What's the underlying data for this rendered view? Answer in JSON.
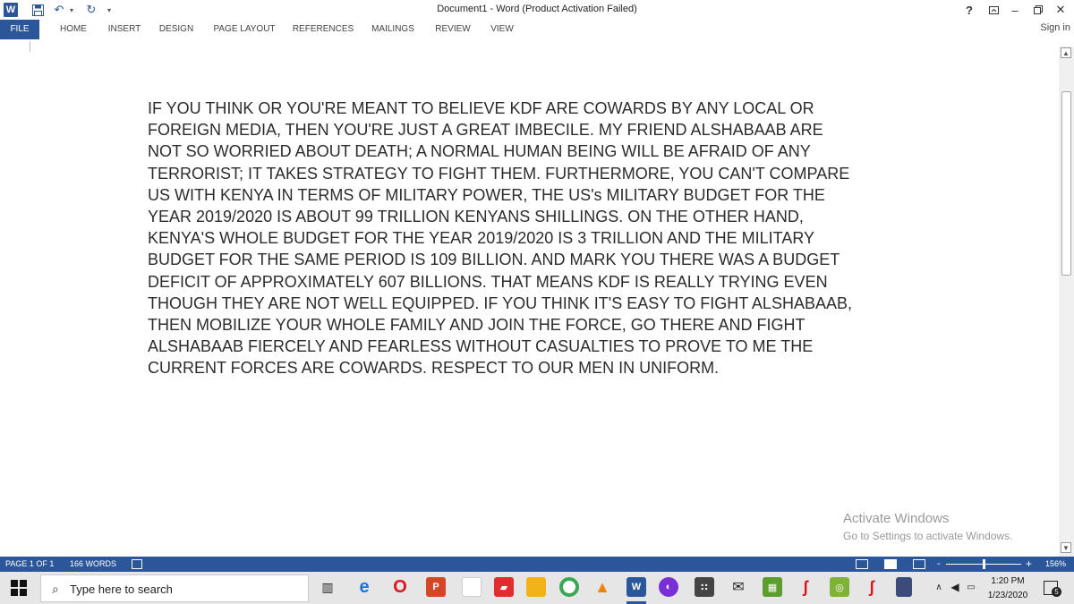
{
  "titlebar": {
    "title": "Document1 - Word (Product Activation Failed)",
    "help": "?"
  },
  "ribbon": {
    "tabs": [
      "FILE",
      "HOME",
      "INSERT",
      "DESIGN",
      "PAGE LAYOUT",
      "REFERENCES",
      "MAILINGS",
      "REVIEW",
      "VIEW"
    ],
    "sign_in": "Sign in"
  },
  "document": {
    "text": "IF YOU THINK OR YOU'RE MEANT TO BELIEVE KDF ARE COWARDS BY ANY LOCAL OR\nFOREIGN MEDIA, THEN YOU'RE JUST A GREAT IMBECILE. MY FRIEND ALSHABAAB ARE\nNOT SO WORRIED ABOUT DEATH; A NORMAL HUMAN BEING WILL BE AFRAID OF ANY\nTERRORIST; IT TAKES STRATEGY TO FIGHT THEM. FURTHERMORE, YOU CAN'T COMPARE\nUS WITH KENYA IN TERMS OF MILITARY POWER, THE US's MILITARY BUDGET FOR THE\nYEAR 2019/2020 IS ABOUT 99 TRILLION KENYANS SHILLINGS. ON THE OTHER HAND,\nKENYA'S WHOLE BUDGET FOR THE YEAR 2019/2020 IS 3 TRILLION AND THE MILITARY\nBUDGET FOR THE SAME PERIOD IS 109 BILLION. AND MARK YOU THERE WAS A BUDGET\nDEFICIT OF APPROXIMATELY 607 BILLIONS. THAT MEANS KDF IS REALLY TRYING EVEN\nTHOUGH THEY ARE NOT WELL EQUIPPED. IF YOU THINK IT'S EASY TO FIGHT ALSHABAAB,\nTHEN MOBILIZE YOUR WHOLE FAMILY AND JOIN THE FORCE, GO THERE AND FIGHT\nALSHABAAB FIERCELY AND FEARLESS WITHOUT CASUALTIES TO PROVE TO ME THE\nCURRENT FORCES ARE COWARDS. RESPECT TO OUR MEN IN UNIFORM."
  },
  "watermark": {
    "line1": "Activate Windows",
    "line2": "Go to Settings to activate Windows."
  },
  "statusbar": {
    "page": "PAGE 1 OF 1",
    "words": "166 WORDS",
    "zoom": "156%",
    "zoom_minus": "-",
    "zoom_plus": "+"
  },
  "taskbar": {
    "search_placeholder": "Type here to search",
    "time": "1:20 PM",
    "date": "1/23/2020",
    "notification_count": "5"
  },
  "colors": {
    "accent": "#2b579a",
    "taskbar": "#e6e6e6"
  }
}
